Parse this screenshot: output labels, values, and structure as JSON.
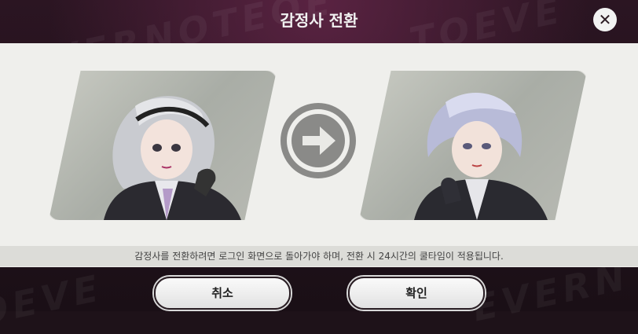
{
  "dialog": {
    "title": "감정사 전환",
    "notice": "감정사를 전환하려면 로그인 화면으로 돌아가야 하며, 전환 시 24시간의 쿨타임이 적용됩니다.",
    "cancel_label": "취소",
    "confirm_label": "확인"
  },
  "icons": {
    "close": "close-icon",
    "arrow": "arrow-right-icon"
  },
  "colors": {
    "backdrop": "#1e1219",
    "panel": "#efefec",
    "notice_bar": "#dcdcd8",
    "arrow": "#8a8a88"
  }
}
